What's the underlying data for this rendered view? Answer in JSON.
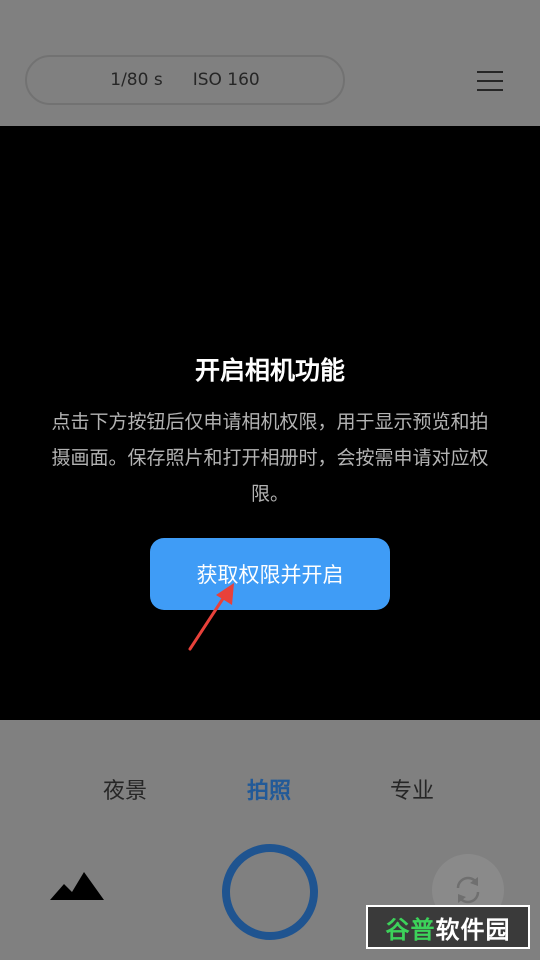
{
  "top": {
    "shutter_speed": "1/80 s",
    "iso": "ISO 160"
  },
  "permission": {
    "title": "开启相机功能",
    "description": "点击下方按钮后仅申请相机权限，用于显示预览和拍摄画面。保存照片和打开相册时，会按需申请对应权限。",
    "button_label": "获取权限并开启"
  },
  "modes": [
    {
      "label": "夜景",
      "active": false
    },
    {
      "label": "拍照",
      "active": true
    },
    {
      "label": "专业",
      "active": false
    }
  ],
  "watermark": {
    "part1": "谷普",
    "part2": "软件园"
  },
  "colors": {
    "accent": "#3f9cf6",
    "active_mode": "#225a98",
    "shutter_ring": "#1f5490",
    "annotation_arrow": "#e8413a"
  },
  "icons": [
    "menu-icon",
    "gallery-mountains-icon",
    "camera-switch-icon",
    "annotation-arrow"
  ]
}
